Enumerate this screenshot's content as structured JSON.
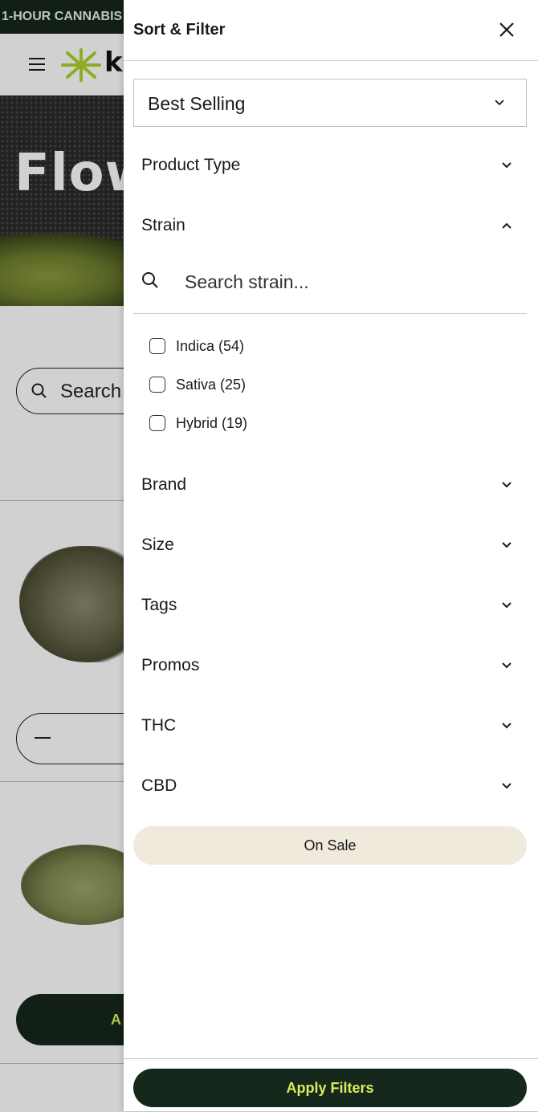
{
  "background": {
    "banner_text": "1-HOUR CANNABIS",
    "logo_text": "k",
    "hero_title": "Flow",
    "search_text": "Search",
    "add_button_text": "A"
  },
  "drawer": {
    "title": "Sort & Filter",
    "sort": {
      "selected": "Best Selling"
    },
    "sections": {
      "product_type": "Product Type",
      "strain": "Strain",
      "brand": "Brand",
      "size": "Size",
      "tags": "Tags",
      "promos": "Promos",
      "thc": "THC",
      "cbd": "CBD"
    },
    "strain_search_placeholder": "Search strain...",
    "strain_options": [
      {
        "label": "Indica (54)",
        "checked": false
      },
      {
        "label": "Sativa (25)",
        "checked": false
      },
      {
        "label": "Hybrid (19)",
        "checked": false
      }
    ],
    "on_sale_label": "On Sale",
    "apply_label": "Apply Filters"
  },
  "colors": {
    "dark_green": "#16271c",
    "lime": "#d8f05a",
    "on_sale_bg": "#efeadb"
  },
  "icons": [
    "hamburger-icon",
    "logo-star-icon",
    "search-icon",
    "minus-icon",
    "close-icon",
    "chevron-down-icon",
    "chevron-up-icon"
  ]
}
